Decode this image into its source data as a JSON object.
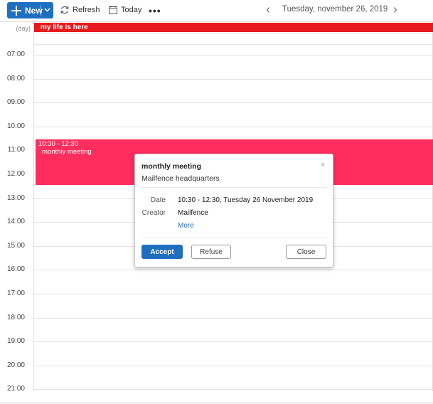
{
  "toolbar": {
    "new_label": "New",
    "refresh_label": "Refresh",
    "today_label": "Today",
    "more_label": "•••",
    "date_title": "Tuesday, november 26, 2019"
  },
  "calendar": {
    "day_label": "(day)",
    "hours": [
      "07:00",
      "08:00",
      "09:00",
      "10:00",
      "11:00",
      "12:00",
      "13:00",
      "14:00",
      "15:00",
      "16:00",
      "17:00",
      "18:00",
      "19:00",
      "20:00",
      "21:00"
    ],
    "allday_event": {
      "title": "my life is here",
      "color": "#e8191c"
    },
    "event": {
      "time": "10:30 - 12:30",
      "title": "monthly meeting",
      "color": "#ff2d5d"
    }
  },
  "popup": {
    "title": "monthly meeting",
    "close_glyph": "×",
    "location": "Mailfence headquarters",
    "date_label": "Date",
    "date_value": "10:30 - 12:30, Tuesday 26 November 2019",
    "creator_label": "Creator",
    "creator_value": "Mailfence",
    "more_link": "More",
    "accept_label": "Accept",
    "refuse_label": "Refuse",
    "close_label": "Close"
  },
  "colors": {
    "accent": "#1f6fc1"
  }
}
